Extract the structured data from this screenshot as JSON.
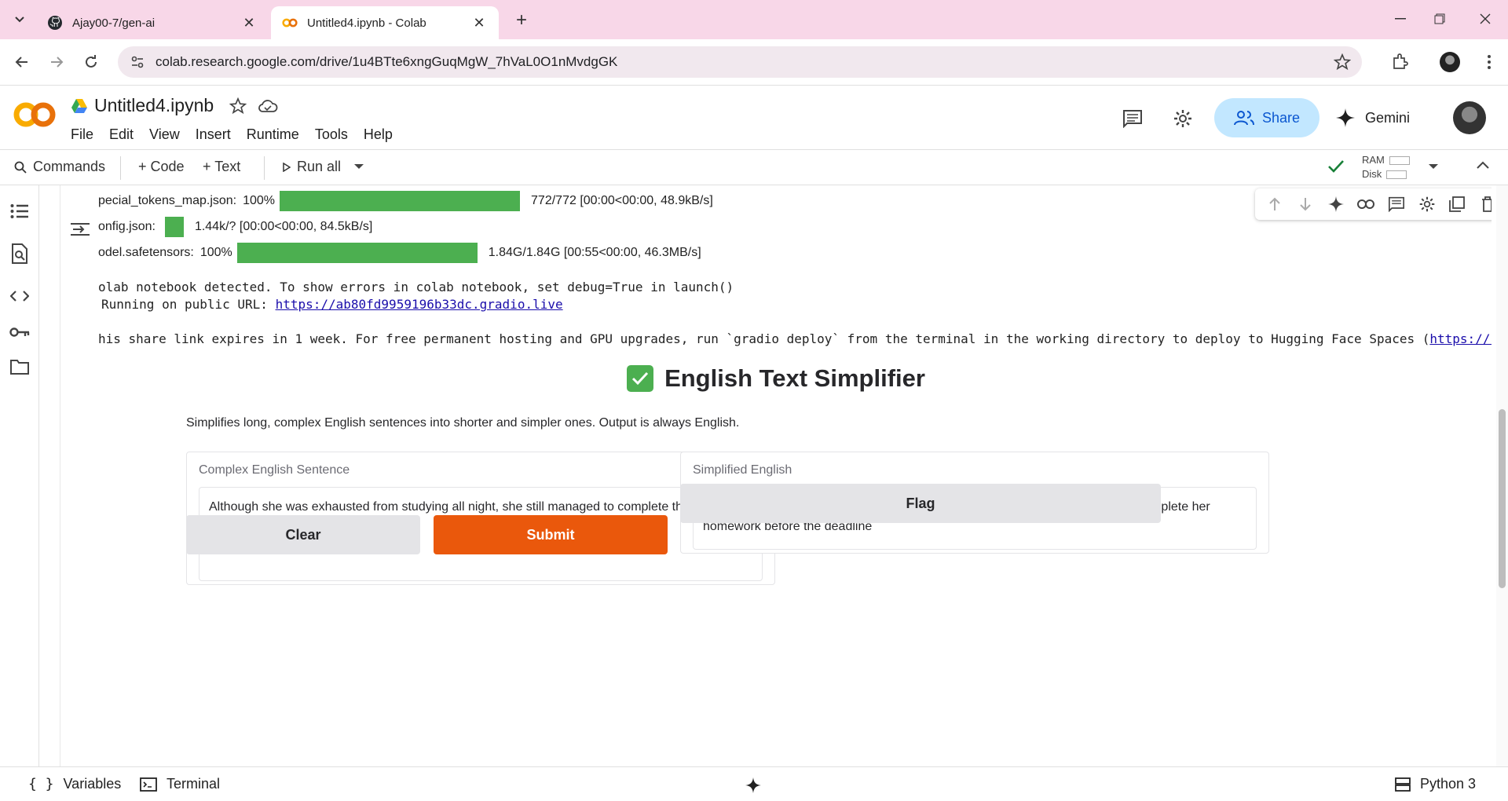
{
  "browser": {
    "tabs": [
      {
        "title": "Ajay00-7/gen-ai",
        "icon": "github-icon"
      },
      {
        "title": "Untitled4.ipynb - Colab",
        "icon": "colab-icon"
      }
    ],
    "url": "colab.research.google.com/drive/1u4BTte6xngGuqMgW_7hVaL0O1nMvdgGK"
  },
  "colab": {
    "notebook_title": "Untitled4.ipynb",
    "menu": [
      "File",
      "Edit",
      "View",
      "Insert",
      "Runtime",
      "Tools",
      "Help"
    ],
    "share_label": "Share",
    "gemini_label": "Gemini",
    "commands_label": "Commands",
    "code_label": "+ Code",
    "text_label": "+ Text",
    "run_all_label": "Run all",
    "ram_label": "RAM",
    "disk_label": "Disk"
  },
  "output": {
    "progress": [
      {
        "name": "pecial_tokens_map.json:",
        "pct_text": "100%",
        "stats": "772/772  [00:00<00:00,  48.9kB/s]",
        "fraction": 1.0
      },
      {
        "name": "onfig.json:",
        "pct_text": "",
        "stats": "1.44k/?  [00:00<00:00,  84.5kB/s]",
        "fraction": 1.0
      },
      {
        "name": "odel.safetensors:",
        "pct_text": "100%",
        "stats": "1.84G/1.84G  [00:55<00:00,  46.3MB/s]",
        "fraction": 1.0
      }
    ],
    "line1": "olab notebook detected. To show errors in colab notebook, set debug=True in launch()",
    "line2_prefix": "Running on public URL: ",
    "public_url": "https://ab80fd9959196b33dc.gradio.live",
    "line3_text": "his share link expires in 1 week. For free permanent hosting and GPU upgrades, run `gradio deploy` from the terminal in the working directory to deploy to Hugging Face Spaces (",
    "line3_link": "https://h"
  },
  "gradio": {
    "title": "English Text Simplifier",
    "description": "Simplifies long, complex English sentences into shorter and simpler ones. Output is always English.",
    "input_label": "Complex English Sentence",
    "input_value": "Although she was exhausted from studying all night, she still managed to complete the assignment before the deadline",
    "output_label": "Simplified English",
    "output_value": "Even though she was exhausted from studying all night, Julia still manages to complete her homework before the deadline",
    "clear_label": "Clear",
    "submit_label": "Submit",
    "flag_label": "Flag"
  },
  "footer": {
    "variables_label": "Variables",
    "terminal_label": "Terminal",
    "runtime_label": "Python 3"
  },
  "colors": {
    "accent_submit": "#ea580c",
    "progress_green": "#4caf50",
    "share_bg": "#c2e7ff"
  }
}
